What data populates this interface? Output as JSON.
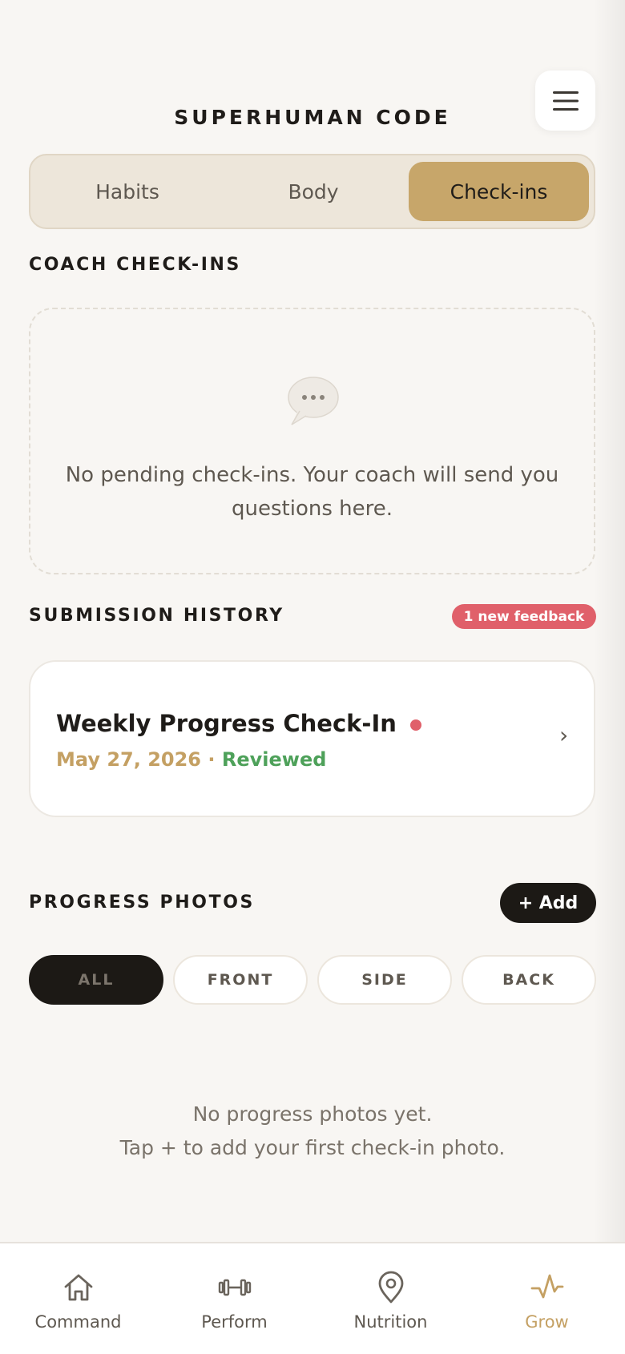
{
  "header": {
    "title": "SUPERHUMAN CODE",
    "menu_icon": "hamburger-menu-icon"
  },
  "tabs": [
    {
      "label": "Habits",
      "active": false
    },
    {
      "label": "Body",
      "active": false
    },
    {
      "label": "Check-ins",
      "active": true
    }
  ],
  "coach_checkins": {
    "heading": "COACH CHECK-INS",
    "empty_icon": "speech-bubble-icon",
    "empty_text": "No pending check-ins. Your coach will send you questions here."
  },
  "submission_history": {
    "heading": "SUBMISSION HISTORY",
    "badge": "1 new feedback",
    "items": [
      {
        "title": "Weekly Progress Check-In",
        "date": "May 27, 2026",
        "separator": "·",
        "status": "Reviewed",
        "unread": true,
        "chevron": "›"
      }
    ]
  },
  "progress_photos": {
    "heading": "PROGRESS PHOTOS",
    "add_label": "+ Add",
    "filters": [
      {
        "label": "ALL",
        "active": true
      },
      {
        "label": "FRONT",
        "active": false
      },
      {
        "label": "SIDE",
        "active": false
      },
      {
        "label": "BACK",
        "active": false
      }
    ],
    "empty_line1": "No progress photos yet.",
    "empty_line2": "Tap + to add your first check-in photo."
  },
  "bottom_nav": [
    {
      "label": "Command",
      "icon": "home-icon",
      "active": false
    },
    {
      "label": "Perform",
      "icon": "dumbbell-icon",
      "active": false
    },
    {
      "label": "Nutrition",
      "icon": "location-pin-icon",
      "active": false
    },
    {
      "label": "Grow",
      "icon": "activity-pulse-icon",
      "active": true
    }
  ],
  "colors": {
    "accent_gold": "#c7a66a",
    "background": "#f8f6f3",
    "badge_red": "#e0606a",
    "status_green": "#4ea15a",
    "dark": "#1c1915"
  }
}
